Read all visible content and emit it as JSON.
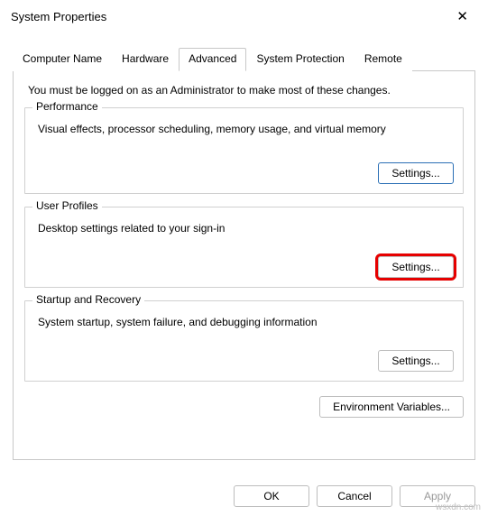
{
  "window": {
    "title": "System Properties"
  },
  "tabs": {
    "computer_name": "Computer Name",
    "hardware": "Hardware",
    "advanced": "Advanced",
    "system_protection": "System Protection",
    "remote": "Remote"
  },
  "intro": "You must be logged on as an Administrator to make most of these changes.",
  "groups": {
    "performance": {
      "legend": "Performance",
      "desc": "Visual effects, processor scheduling, memory usage, and virtual memory",
      "button": "Settings..."
    },
    "user_profiles": {
      "legend": "User Profiles",
      "desc": "Desktop settings related to your sign-in",
      "button": "Settings..."
    },
    "startup_recovery": {
      "legend": "Startup and Recovery",
      "desc": "System startup, system failure, and debugging information",
      "button": "Settings..."
    }
  },
  "env_button": "Environment Variables...",
  "footer": {
    "ok": "OK",
    "cancel": "Cancel",
    "apply": "Apply"
  },
  "watermark": "wsxdn.com"
}
